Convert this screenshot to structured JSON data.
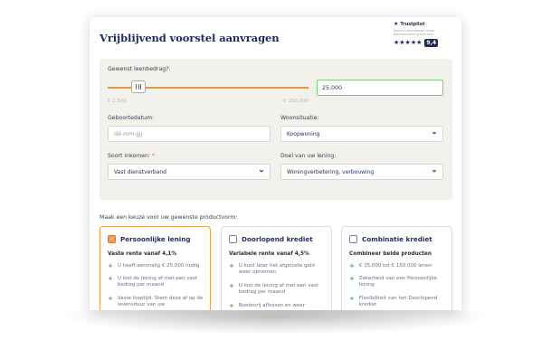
{
  "page_title": "Vrijblijvend voorstel aanvragen",
  "trustpilot": {
    "brand": "Trustpilot",
    "subtext": "Klanten beoordelen onze dienstverlening met een",
    "stars": "★★★★★",
    "score": "9,4"
  },
  "form": {
    "amount_label": "Gewenst leenbedrag?:",
    "slider_min_label": "€ 2.500",
    "slider_max_label": "€ 150.000",
    "slider_value_fraction": 0.154,
    "amount_value": "25.000",
    "birthdate_label": "Geboortedatum:",
    "birthdate_placeholder": "dd-mm-jjjj",
    "housing_label": "Woonsituatie:",
    "housing_value": "Koopwoning",
    "income_label": "Soort inkomen:",
    "income_required": "*",
    "income_value": "Vast dienstverband",
    "purpose_label": "Doel van uw lening:",
    "purpose_value": "Woningverbetering, verbouwing"
  },
  "product_prompt": "Maak een keuze voor uw gewenste productvorm:",
  "products": [
    {
      "title": "Persoonlijke lening",
      "selected": true,
      "subtitle": "Vaste rente vanaf 4,1%",
      "features": [
        "U heeft eenmalig € 25.000 nodig",
        "U lost de lening af met een vast bedrag per maand",
        "Vaste looptijd. Stem deze af op de levensduur van uw"
      ]
    },
    {
      "title": "Doorlopend krediet",
      "selected": false,
      "subtitle": "Variabele rente vanaf 4,5%",
      "features": [
        "U kunt later het afgeloste geld weer opnemen",
        "U lost de lening af met een vast bedrag per maand",
        "Boetevrij aflossen en weer"
      ]
    },
    {
      "title": "Combinatie krediet",
      "selected": false,
      "subtitle": "Combineer beide producten",
      "features": [
        "€ 25.000 tot € 150.000 lenen",
        "Zekerheid van een Persoonlijke lening",
        "Flexibiliteit van het Doorlopend krediet"
      ]
    }
  ],
  "colors": {
    "accent": "#e9973f",
    "navy": "#1f2b5c",
    "success": "#3bb24a",
    "panel": "#f2f1ec"
  }
}
